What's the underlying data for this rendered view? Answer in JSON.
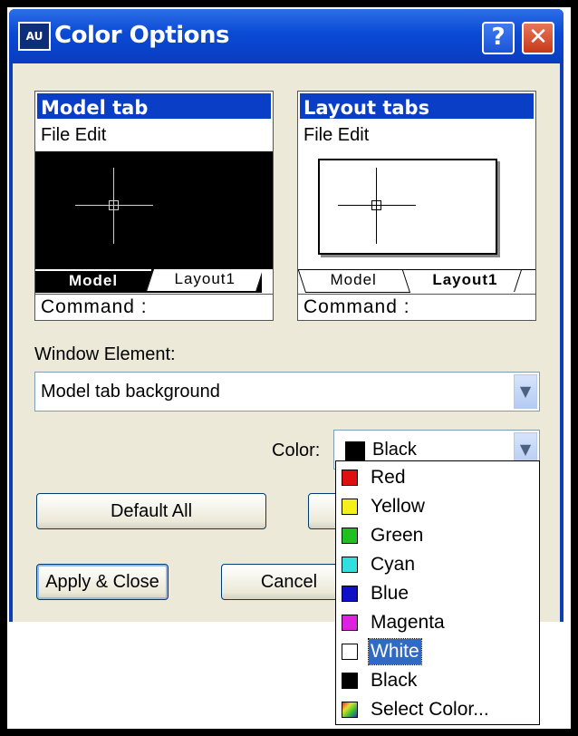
{
  "window": {
    "title": "Color Options",
    "app_icon_text": "AU",
    "help_label": "?",
    "close_label": "✕"
  },
  "model_panel": {
    "title": "Model tab",
    "menu": "File  Edit",
    "tab_active": "Model",
    "tab_inactive": "Layout1",
    "command": "Command :"
  },
  "layout_panel": {
    "title": "Layout tabs",
    "menu": "File  Edit",
    "tab_inactive": "Model",
    "tab_active": "Layout1",
    "command": "Command :"
  },
  "window_element": {
    "label": "Window Element:",
    "value": "Model tab background"
  },
  "color": {
    "label": "Color:",
    "value": "Black",
    "swatch": "#000000"
  },
  "buttons": {
    "default_all": "Default All",
    "apply_close": "Apply & Close",
    "cancel": "Cancel"
  },
  "dropdown": {
    "items": [
      {
        "label": "Red",
        "color": "#e01010"
      },
      {
        "label": "Yellow",
        "color": "#f4f01a"
      },
      {
        "label": "Green",
        "color": "#20c020"
      },
      {
        "label": "Cyan",
        "color": "#30e0e0"
      },
      {
        "label": "Blue",
        "color": "#1010c8"
      },
      {
        "label": "Magenta",
        "color": "#e020e0"
      },
      {
        "label": "White",
        "color": "#ffffff",
        "selected": true
      },
      {
        "label": "Black",
        "color": "#000000"
      },
      {
        "label": "Select Color...",
        "color": "multicolor"
      }
    ]
  }
}
